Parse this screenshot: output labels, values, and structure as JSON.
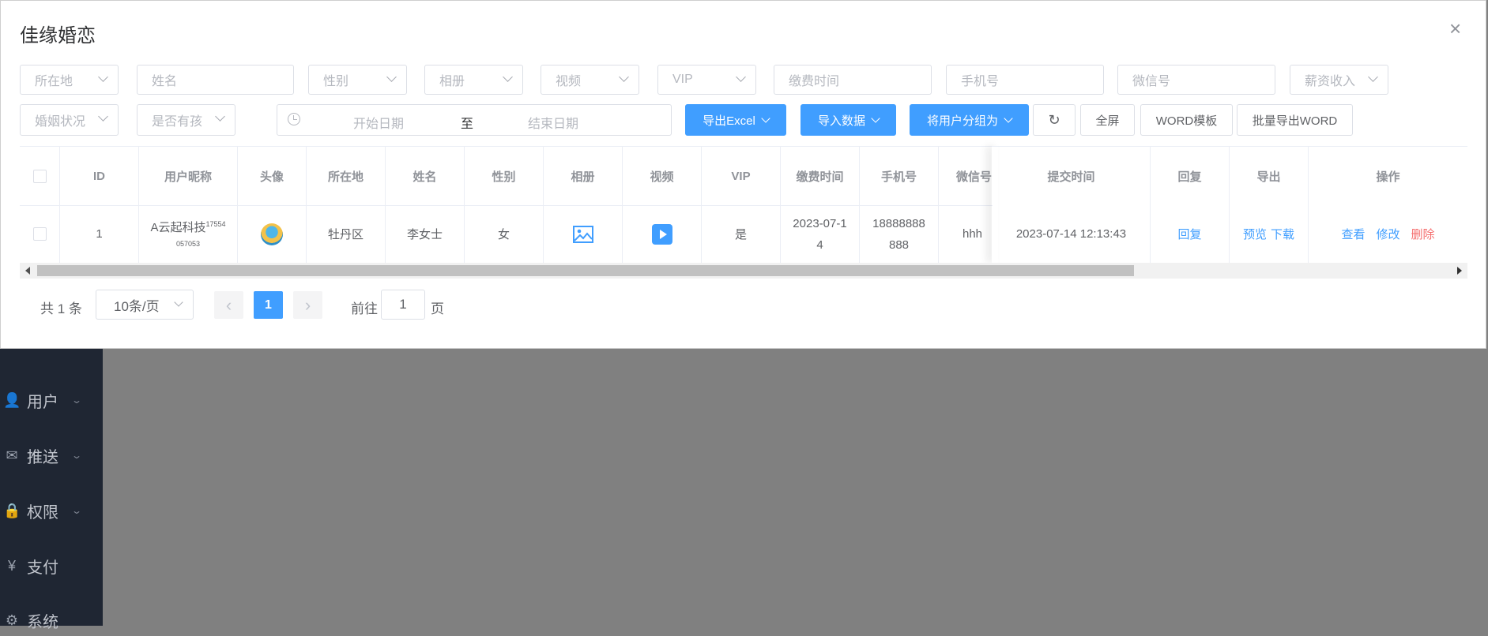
{
  "sidebar": {
    "items": [
      {
        "label": "用户",
        "icon": "user-icon",
        "glyph": "👤"
      },
      {
        "label": "推送",
        "icon": "mail-icon",
        "glyph": "✉"
      },
      {
        "label": "权限",
        "icon": "lock-icon",
        "glyph": "🔒"
      },
      {
        "label": "支付",
        "icon": "yen-icon",
        "glyph": "¥"
      },
      {
        "label": "系统",
        "icon": "gear-icon",
        "glyph": "⚙"
      }
    ]
  },
  "dialog": {
    "title": "佳缘婚恋",
    "close_glyph": "×"
  },
  "filters": {
    "location": "所在地",
    "name": "姓名",
    "gender": "性别",
    "album": "相册",
    "video": "视频",
    "vip": "VIP",
    "pay_time": "缴费时间",
    "phone": "手机号",
    "wechat": "微信号",
    "salary": "薪资收入",
    "marital": "婚姻状况",
    "children": "是否有孩",
    "date_start": "开始日期",
    "date_sep": "至",
    "date_end": "结束日期"
  },
  "toolbar": {
    "export_excel": "导出Excel",
    "import_data": "导入数据",
    "group_users": "将用户分组为",
    "refresh_glyph": "↻",
    "fullscreen": "全屏",
    "word_template": "WORD模板",
    "batch_export_word": "批量导出WORD"
  },
  "table": {
    "headers": {
      "id": "ID",
      "nickname": "用户昵称",
      "avatar": "头像",
      "location": "所在地",
      "name": "姓名",
      "gender": "性别",
      "album": "相册",
      "video": "视频",
      "vip": "VIP",
      "pay_time": "缴费时间",
      "phone": "手机号",
      "wechat": "微信号",
      "submit_time": "提交时间",
      "reply": "回复",
      "export": "导出",
      "actions": "操作"
    },
    "row": {
      "id": "1",
      "nickname": "A云起科技",
      "nickname_sup": "17554",
      "nickname_sub": "057053",
      "location": "牡丹区",
      "name": "李女士",
      "gender": "女",
      "vip": "是",
      "pay_time": "2023-07-14",
      "phone": "18888888888",
      "wechat": "hhh",
      "submit_time": "2023-07-14 12:13:43",
      "reply": "回复",
      "preview": "预览",
      "download": "下载",
      "view": "查看",
      "edit": "修改",
      "delete": "删除"
    }
  },
  "pagination": {
    "total": "共 1 条",
    "page_size": "10条/页",
    "prev_glyph": "‹",
    "current_page": "1",
    "next_glyph": "›",
    "goto_label": "前往",
    "goto_value": "1",
    "page_unit": "页"
  },
  "colors": {
    "primary": "#409eff",
    "danger": "#f56c6c",
    "sidebar_bg": "#1f2633",
    "overlay": "#808080"
  }
}
